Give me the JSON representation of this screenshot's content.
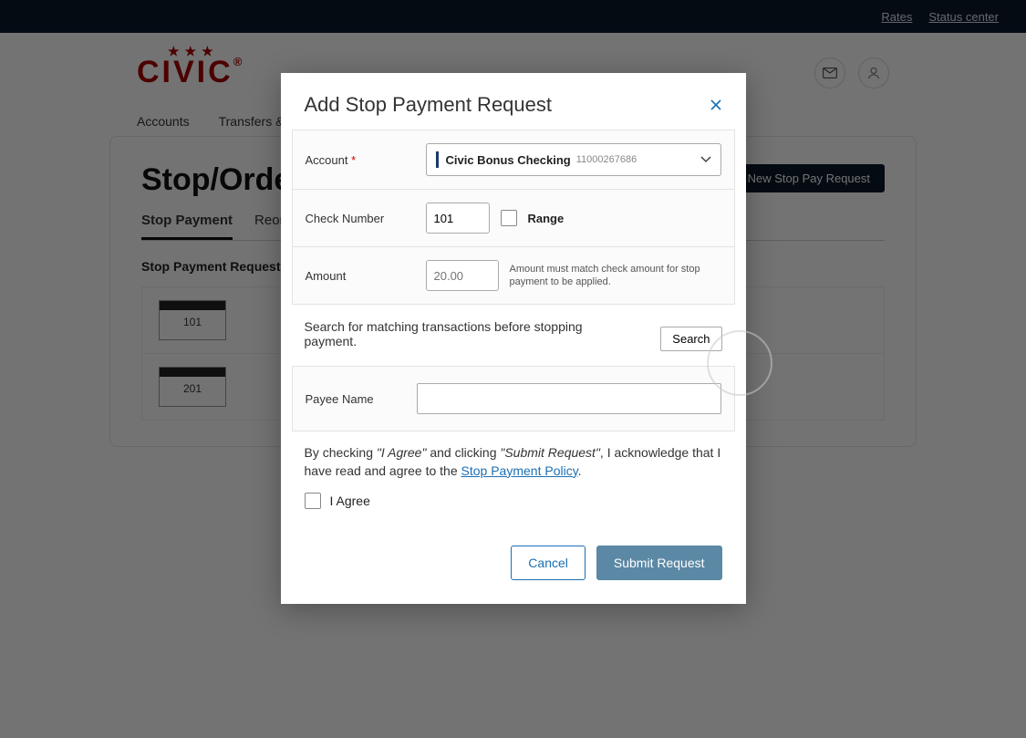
{
  "topbar": {
    "rates": "Rates",
    "status_center": "Status center"
  },
  "logo": {
    "text": "CIVIC",
    "trademark": "®"
  },
  "nav": {
    "accounts": "Accounts",
    "transfers": "Transfers & Pa"
  },
  "page": {
    "title": "Stop/Orde",
    "tabs": {
      "stop": "Stop Payment",
      "reorder": "Reorde"
    },
    "requests_title": "Stop Payment Requests",
    "new_button": "New Stop Pay Request",
    "cards": [
      "101",
      "201"
    ]
  },
  "modal": {
    "title": "Add Stop Payment Request",
    "account_label": "Account",
    "account_name": "Civic Bonus Checking",
    "account_number": "11000267686",
    "check_label": "Check Number",
    "check_value": "101",
    "range_label": "Range",
    "amount_label": "Amount",
    "amount_placeholder": "20.00",
    "amount_help": "Amount must match check amount for stop payment to be applied.",
    "search_text": "Search for matching transactions before stopping payment.",
    "search_btn": "Search",
    "payee_label": "Payee Name",
    "legal_pre": "By checking ",
    "legal_q1": "\"I Agree\"",
    "legal_mid": " and clicking ",
    "legal_q2": "\"Submit Request\"",
    "legal_post": ", I acknowledge that I have read and agree to the ",
    "legal_link": "Stop Payment Policy",
    "legal_end": ".",
    "agree_label": "I Agree",
    "cancel": "Cancel",
    "submit": "Submit Request"
  }
}
